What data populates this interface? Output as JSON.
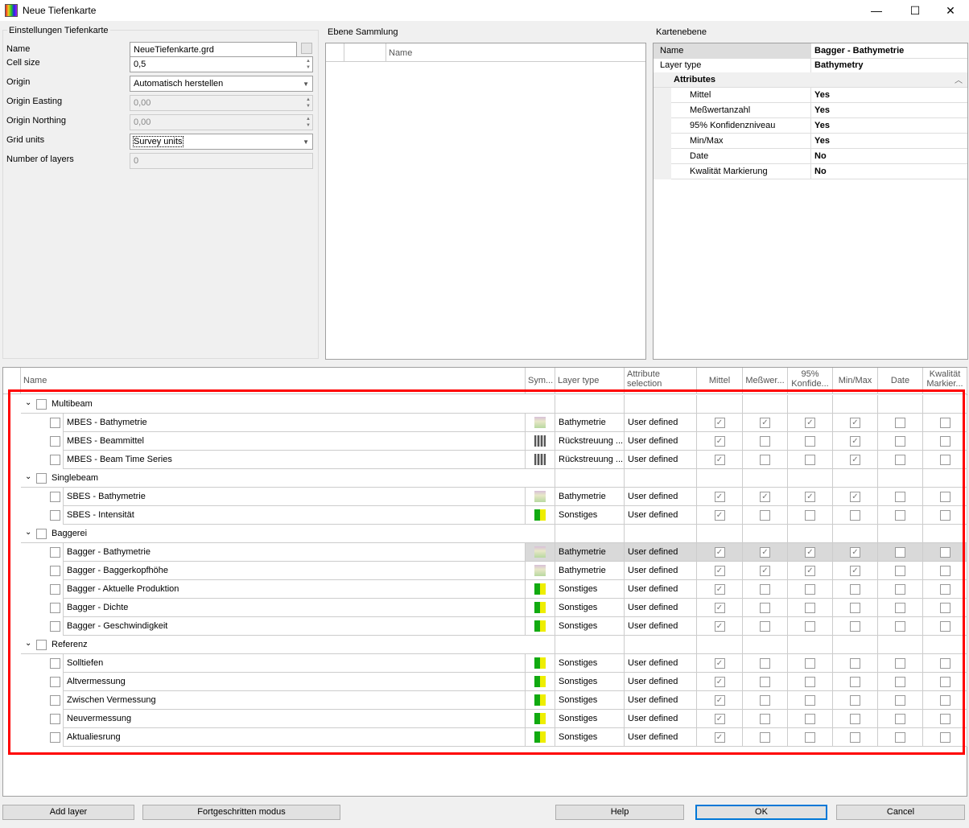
{
  "window": {
    "title": "Neue Tiefenkarte",
    "minimize": "—",
    "maximize": "☐",
    "close": "✕"
  },
  "settings": {
    "title": "Einstellungen Tiefenkarte",
    "name_label": "Name",
    "name_value": "NeueTiefenkarte.grd",
    "cell_label": "Cell size",
    "cell_value": "0,5",
    "origin_label": "Origin",
    "origin_value": "Automatisch herstellen",
    "easting_label": "Origin Easting",
    "easting_value": "0,00",
    "northing_label": "Origin Northing",
    "northing_value": "0,00",
    "units_label": "Grid units",
    "units_value": "Survey units",
    "layers_label": "Number of layers",
    "layers_value": "0"
  },
  "collection": {
    "title": "Ebene Sammlung",
    "col_name": "Name"
  },
  "map_layer": {
    "title": "Kartenebene",
    "rows": [
      {
        "k": "Name",
        "v": "Bagger - Bathymetrie"
      },
      {
        "k": "Layer type",
        "v": "Bathymetry"
      }
    ],
    "attributes_title": "Attributes",
    "attributes": [
      {
        "k": "Mittel",
        "v": "Yes"
      },
      {
        "k": "Meßwertanzahl",
        "v": "Yes"
      },
      {
        "k": "95% Konfidenzniveau",
        "v": "Yes"
      },
      {
        "k": "Min/Max",
        "v": "Yes"
      },
      {
        "k": "Date",
        "v": "No"
      },
      {
        "k": "Kwalität Markierung",
        "v": "No"
      }
    ]
  },
  "grid": {
    "columns": [
      "Name",
      "Sym...",
      "Layer type",
      "Attribute selection",
      "Mittel",
      "Meßwer...",
      "95% Konfide...",
      "Min/Max",
      "Date",
      "Kwalität Markier..."
    ],
    "groups": [
      {
        "name": "Multibeam",
        "rows": [
          {
            "name": "MBES - Bathymetrie",
            "sym": "bathy",
            "type": "Bathymetrie",
            "attr": "User defined",
            "checks": [
              1,
              1,
              1,
              1,
              0,
              0
            ]
          },
          {
            "name": "MBES - Beammittel",
            "sym": "backscatter",
            "type": "Rückstreuung ...",
            "attr": "User defined",
            "checks": [
              1,
              0,
              0,
              1,
              0,
              0
            ]
          },
          {
            "name": "MBES - Beam Time Series",
            "sym": "backscatter",
            "type": "Rückstreuung ...",
            "attr": "User defined",
            "checks": [
              1,
              0,
              0,
              1,
              0,
              0
            ]
          }
        ]
      },
      {
        "name": "Singlebeam",
        "rows": [
          {
            "name": "SBES - Bathymetrie",
            "sym": "bathy",
            "type": "Bathymetrie",
            "attr": "User defined",
            "checks": [
              1,
              1,
              1,
              1,
              0,
              0
            ]
          },
          {
            "name": "SBES - Intensität",
            "sym": "other",
            "type": "Sonstiges",
            "attr": "User defined",
            "checks": [
              1,
              0,
              0,
              0,
              0,
              0
            ]
          }
        ]
      },
      {
        "name": "Baggerei",
        "rows": [
          {
            "name": "Bagger - Bathymetrie",
            "sym": "bathy",
            "type": "Bathymetrie",
            "attr": "User defined",
            "checks": [
              1,
              1,
              1,
              1,
              0,
              0
            ],
            "selected": true
          },
          {
            "name": "Bagger - Baggerkopfhöhe",
            "sym": "bathy",
            "type": "Bathymetrie",
            "attr": "User defined",
            "checks": [
              1,
              1,
              1,
              1,
              0,
              0
            ]
          },
          {
            "name": "Bagger - Aktuelle Produktion",
            "sym": "other",
            "type": "Sonstiges",
            "attr": "User defined",
            "checks": [
              1,
              0,
              0,
              0,
              0,
              0
            ]
          },
          {
            "name": "Bagger - Dichte",
            "sym": "other",
            "type": "Sonstiges",
            "attr": "User defined",
            "checks": [
              1,
              0,
              0,
              0,
              0,
              0
            ]
          },
          {
            "name": "Bagger - Geschwindigkeit",
            "sym": "other",
            "type": "Sonstiges",
            "attr": "User defined",
            "checks": [
              1,
              0,
              0,
              0,
              0,
              0
            ]
          }
        ]
      },
      {
        "name": "Referenz",
        "rows": [
          {
            "name": "Solltiefen",
            "sym": "other",
            "type": "Sonstiges",
            "attr": "User defined",
            "checks": [
              1,
              0,
              0,
              0,
              0,
              0
            ]
          },
          {
            "name": "Altvermessung",
            "sym": "other",
            "type": "Sonstiges",
            "attr": "User defined",
            "checks": [
              1,
              0,
              0,
              0,
              0,
              0
            ]
          },
          {
            "name": "Zwischen Vermessung",
            "sym": "other",
            "type": "Sonstiges",
            "attr": "User defined",
            "checks": [
              1,
              0,
              0,
              0,
              0,
              0
            ]
          },
          {
            "name": "Neuvermessung",
            "sym": "other",
            "type": "Sonstiges",
            "attr": "User defined",
            "checks": [
              1,
              0,
              0,
              0,
              0,
              0
            ]
          },
          {
            "name": "Aktualiesrung",
            "sym": "other",
            "type": "Sonstiges",
            "attr": "User defined",
            "checks": [
              1,
              0,
              0,
              0,
              0,
              0
            ]
          }
        ]
      }
    ]
  },
  "buttons": {
    "add": "Add layer",
    "advanced": "Fortgeschritten modus",
    "help": "Help",
    "ok": "OK",
    "cancel": "Cancel"
  },
  "colors": {
    "highlight": "#f00",
    "selected_row": "#d9d9d9",
    "ok_border": "#0078d7"
  }
}
